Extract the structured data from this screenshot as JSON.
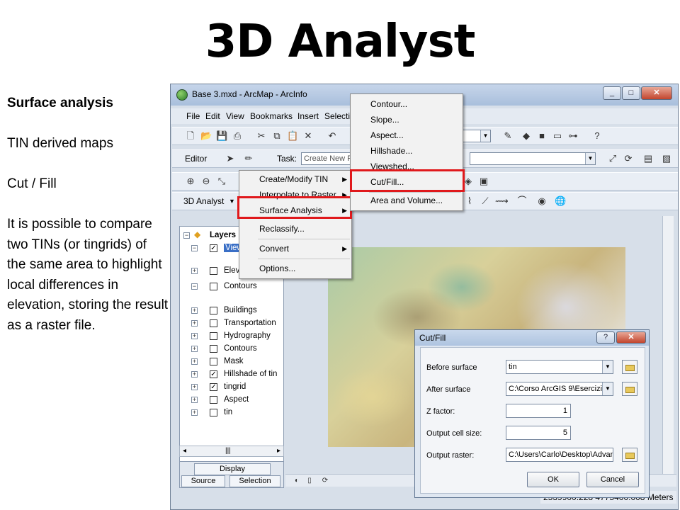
{
  "slide": {
    "title": "3D Analyst",
    "heading": "Surface analysis",
    "line1": "TIN derived maps",
    "line2": "Cut / Fill",
    "paragraph": "It is possible to compare two TINs (or tingrids) of the same area to highlight local differences in elevation, storing the result as a raster file."
  },
  "window": {
    "title": "Base 3.mxd - ArcMap - ArcInfo",
    "menu": [
      "File",
      "Edit",
      "View",
      "Bookmarks",
      "Insert",
      "Selectio"
    ],
    "editor_label": "Editor",
    "task_label": "Task:",
    "task_value": "Create New F",
    "toolbar_3d": "3D Analyst"
  },
  "toc": {
    "root": "Layers",
    "layers": [
      {
        "name": "View",
        "checked": true
      },
      {
        "name": "Elev",
        "checked": false
      },
      {
        "name": "Contours",
        "checked": false
      },
      {
        "name": "Buildings",
        "checked": false
      },
      {
        "name": "Transportation",
        "checked": false
      },
      {
        "name": "Hydrography",
        "checked": false
      },
      {
        "name": "Contours",
        "checked": false
      },
      {
        "name": "Mask",
        "checked": false
      },
      {
        "name": "Hillshade of tin",
        "checked": true
      },
      {
        "name": "tingrid",
        "checked": true
      },
      {
        "name": "Aspect",
        "checked": false
      },
      {
        "name": "tin",
        "checked": false
      }
    ],
    "tab_display": "Display",
    "tab_source": "Source",
    "tab_selection": "Selection"
  },
  "menu_3d": {
    "items": [
      "Create/Modify TIN",
      "Interpolate to Raster",
      "Surface Analysis",
      "Reclassify...",
      "Convert",
      "Options..."
    ]
  },
  "submenu_surface": {
    "items": [
      "Contour...",
      "Slope...",
      "Aspect...",
      "Hillshade...",
      "Viewshed...",
      "Cut/Fill...",
      "Area and Volume..."
    ]
  },
  "cutfill": {
    "title": "Cut/Fill",
    "before_label": "Before surface",
    "before_value": "tin",
    "after_label": "After surface",
    "after_value": "C:\\Corso ArcGIS 9\\Esercizi",
    "z_label": "Z factor:",
    "z_value": "1",
    "cell_label": "Output cell size:",
    "cell_value": "5",
    "raster_label": "Output raster:",
    "raster_value": "C:\\Users\\Carlo\\Desktop\\Advan",
    "ok": "OK",
    "cancel": "Cancel"
  },
  "status": {
    "coords": "2539900.228  4775400.008 Meters"
  },
  "colors": {
    "highlight": "#e0191c",
    "window_frame": "#d7dfe9"
  }
}
